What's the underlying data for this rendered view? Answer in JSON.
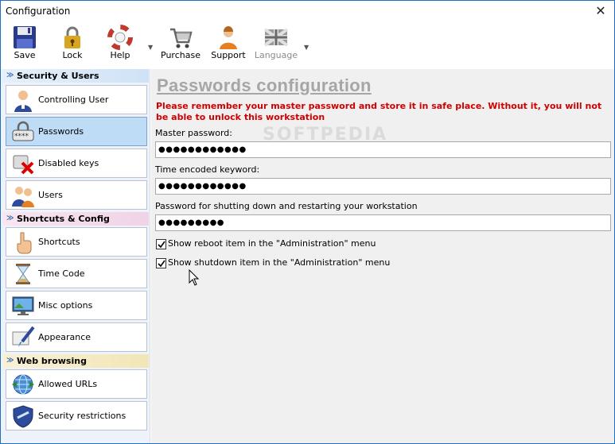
{
  "window": {
    "title": "Configuration",
    "close_glyph": "✕"
  },
  "toolbar": {
    "buttons": [
      {
        "label": "Save",
        "icon": "floppy-disk-icon"
      },
      {
        "label": "Lock",
        "icon": "padlock-icon"
      },
      {
        "label": "Help",
        "icon": "lifebuoy-icon"
      },
      {
        "label": "Purchase",
        "icon": "shopping-cart-icon"
      },
      {
        "label": "Support",
        "icon": "support-agent-icon"
      },
      {
        "label": "Language",
        "icon": "uk-flag-icon",
        "disabled": true
      }
    ],
    "dropdown_glyph": "▼"
  },
  "sidebar": {
    "sections": [
      {
        "title": "Security & Users",
        "items": [
          "Controlling User",
          "Passwords",
          "Disabled keys",
          "Users"
        ]
      },
      {
        "title": "Shortcuts & Config",
        "items": [
          "Shortcuts",
          "Time Code",
          "Misc options",
          "Appearance"
        ]
      },
      {
        "title": "Web browsing",
        "items": [
          "Allowed URLs",
          "Security restrictions"
        ]
      }
    ],
    "selected": "Passwords",
    "chevron": "≫"
  },
  "main": {
    "title": "Passwords configuration",
    "warning": "Please remember your master password and store it in safe place. Without it, you will not be able to unlock this workstation",
    "master_password": {
      "label": "Master password:",
      "value": "●●●●●●●●●●●●"
    },
    "time_keyword": {
      "label": "Time encoded keyword:",
      "value": "●●●●●●●●●●●●"
    },
    "shutdown_password": {
      "label": "Password for shutting down and restarting your workstation",
      "value": "●●●●●●●●●"
    },
    "checkboxes": [
      {
        "label": "Show reboot item in the \"Administration\" menu",
        "checked": true
      },
      {
        "label": "Show shutdown item in the \"Administration\" menu",
        "checked": true
      }
    ],
    "watermark": "SOFTPEDIA"
  },
  "colors": {
    "accent": "#1e6fbf",
    "warning": "#d10000",
    "title_gray": "#a6a6a6",
    "selected_bg": "#bfdcf7"
  }
}
